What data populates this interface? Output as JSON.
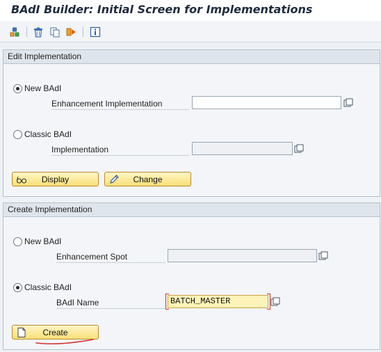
{
  "window": {
    "title": "BAdI Builder: Initial Screen for Implementations"
  },
  "toolbar": {
    "buttons": [
      {
        "name": "other-object-icon"
      },
      {
        "name": "delete-icon"
      },
      {
        "name": "copy-icon"
      },
      {
        "name": "rename-icon"
      },
      {
        "name": "information-icon"
      }
    ]
  },
  "edit_group": {
    "header": "Edit Implementation",
    "new_badi": {
      "label": "New BAdI",
      "checked": true,
      "field_label": "Enhancement Implementation",
      "value": ""
    },
    "classic_badi": {
      "label": "Classic BAdI",
      "checked": false,
      "field_label": "Implementation",
      "value": ""
    },
    "display_button": "Display",
    "change_button": "Change"
  },
  "create_group": {
    "header": "Create Implementation",
    "new_badi": {
      "label": "New BAdI",
      "checked": false,
      "field_label": "Enhancement Spot",
      "value": ""
    },
    "classic_badi": {
      "label": "Classic BAdI",
      "checked": true,
      "field_label": "BAdI Name",
      "value": "BATCH_MASTER"
    },
    "create_button": "Create"
  },
  "colors": {
    "button_fill": "#f9df78",
    "button_border": "#b88a2f",
    "focused_input": "#fdf3b8",
    "annotation_red": "#d23030",
    "group_header": "#dfe5ec"
  }
}
